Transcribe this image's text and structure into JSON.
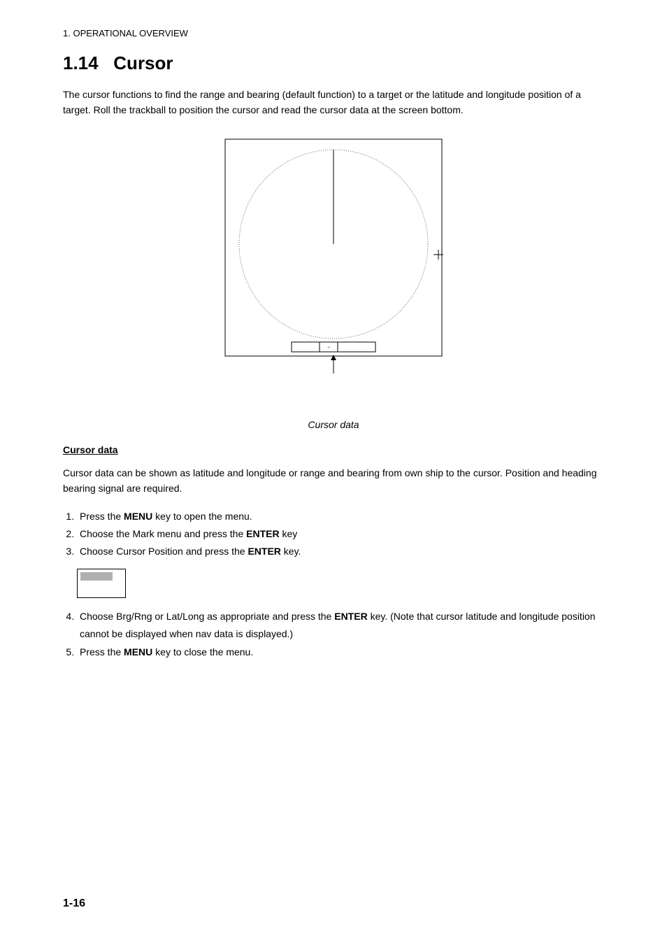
{
  "header": {
    "chapter": "1. OPERATIONAL OVERVIEW"
  },
  "section": {
    "number": "1.14",
    "title": "Cursor"
  },
  "intro": {
    "text": "The cursor functions to find the range and bearing (default function) to a target or the latitude and longitude position of a target. Roll the trackball to position the cursor and read the cursor data at the screen bottom."
  },
  "figure": {
    "caption": "Cursor data"
  },
  "subheading": {
    "text": "Cursor data"
  },
  "subintro": {
    "text": "Cursor data can be shown as latitude and longitude or range and bearing from own ship to the cursor. Position and heading bearing signal are required."
  },
  "steps": {
    "s1_a": "Press the ",
    "s1_b": "MENU",
    "s1_c": " key to open the menu.",
    "s2_a": "Choose the Mark menu and press the ",
    "s2_b": "ENTER",
    "s2_c": " key",
    "s3_a": "Choose Cursor Position and press the ",
    "s3_b": "ENTER",
    "s3_c": " key.",
    "s4_a": "Choose Brg/Rng or Lat/Long as appropriate and press the ",
    "s4_b": "ENTER",
    "s4_c": " key. (Note that cursor latitude and longitude position cannot be displayed when nav data is displayed.)",
    "s5_a": "Press the ",
    "s5_b": "MENU",
    "s5_c": " key to close the menu."
  },
  "page": {
    "number": "1-16"
  }
}
